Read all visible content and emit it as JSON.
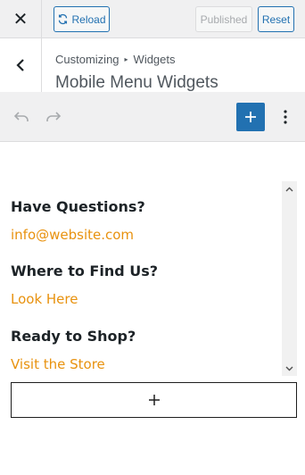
{
  "topbar": {
    "close_icon": "close-icon",
    "reload_label": "Reload",
    "published_label": "Published",
    "reset_label": "Reset"
  },
  "section": {
    "breadcrumb": [
      "Customizing",
      "Widgets"
    ],
    "title": "Mobile Menu Widgets"
  },
  "toolbar": {
    "undo_icon": "undo-icon",
    "redo_icon": "redo-icon",
    "inserter_icon": "plus-icon",
    "more_icon": "more-vertical-icon",
    "accent": "#2271b1"
  },
  "widgets": [
    {
      "heading": "Have Questions?",
      "link": "info@website.com"
    },
    {
      "heading": "Where to Find Us?",
      "link": "Look Here"
    },
    {
      "heading": "Ready to Shop?",
      "link": "Visit the Store"
    }
  ],
  "colors": {
    "link": "#e8920f",
    "heading": "#1d2327"
  }
}
